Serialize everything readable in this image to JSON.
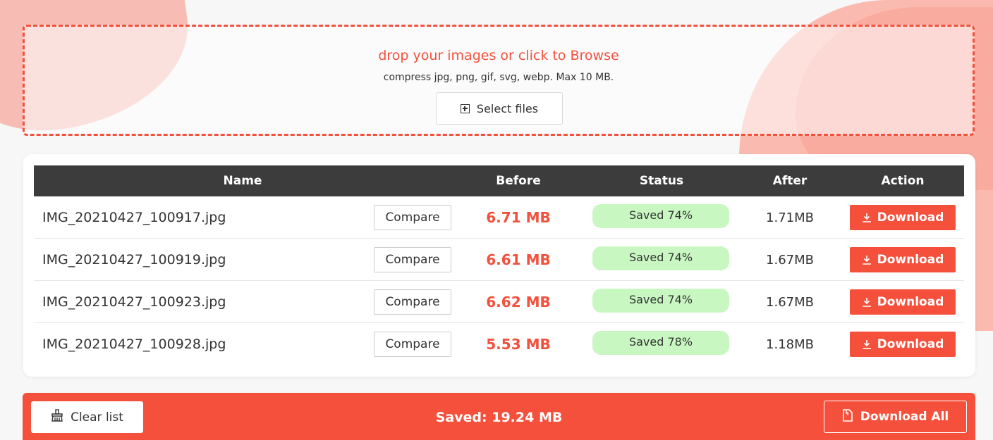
{
  "dropzone": {
    "title": "drop your images or click to Browse",
    "subtitle": "compress jpg, png, gif, svg, webp. Max 10 MB.",
    "select_label": "Select files",
    "select_icon": "plus-square-icon"
  },
  "table": {
    "headers": {
      "name": "Name",
      "before": "Before",
      "status": "Status",
      "after": "After",
      "action": "Action"
    },
    "rows": [
      {
        "name": "IMG_20210427_100917.jpg",
        "compare": "Compare",
        "before": "6.71 MB",
        "status": "Saved 74%",
        "after": "1.71MB",
        "action": "Download"
      },
      {
        "name": "IMG_20210427_100919.jpg",
        "compare": "Compare",
        "before": "6.61 MB",
        "status": "Saved 74%",
        "after": "1.67MB",
        "action": "Download"
      },
      {
        "name": "IMG_20210427_100923.jpg",
        "compare": "Compare",
        "before": "6.62 MB",
        "status": "Saved 74%",
        "after": "1.67MB",
        "action": "Download"
      },
      {
        "name": "IMG_20210427_100928.jpg",
        "compare": "Compare",
        "before": "5.53 MB",
        "status": "Saved 78%",
        "after": "1.18MB",
        "action": "Download"
      }
    ]
  },
  "footer": {
    "clear_label": "Clear list",
    "clear_icon": "broom-icon",
    "saved_total": "Saved: 19.24 MB",
    "download_all_label": "Download All",
    "download_all_icon": "file-icon"
  },
  "colors": {
    "accent": "#f4503c",
    "header_bg": "#3c3c3c",
    "status_bg": "#c9f7c2"
  }
}
